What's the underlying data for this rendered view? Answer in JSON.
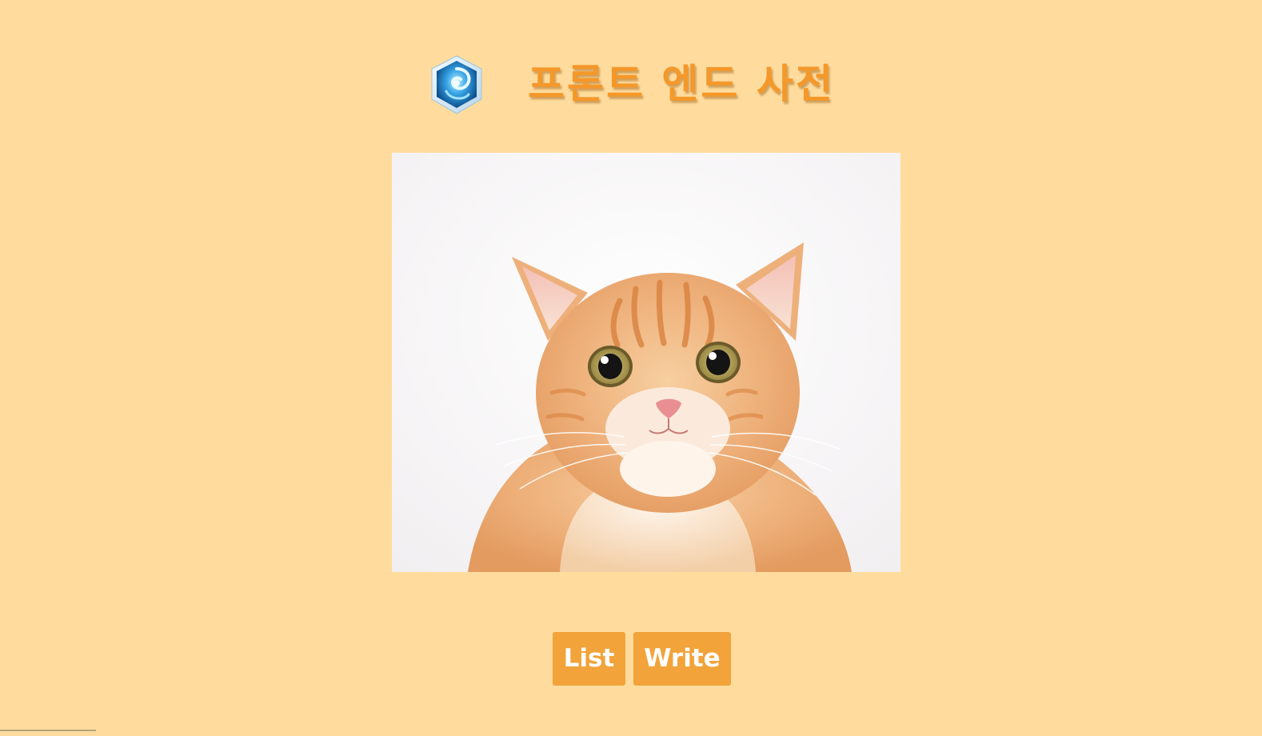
{
  "header": {
    "title": "프론트 엔드 사전",
    "logo_icon": "crystal-swirl-logo-icon"
  },
  "main": {
    "image_subject": "orange-tabby-cat-photo"
  },
  "actions": {
    "list_label": "List",
    "write_label": "Write"
  },
  "colors": {
    "background": "#ffdc9d",
    "title": "#f4982a",
    "button": "#f2a33a",
    "button_text": "#ffffff"
  }
}
